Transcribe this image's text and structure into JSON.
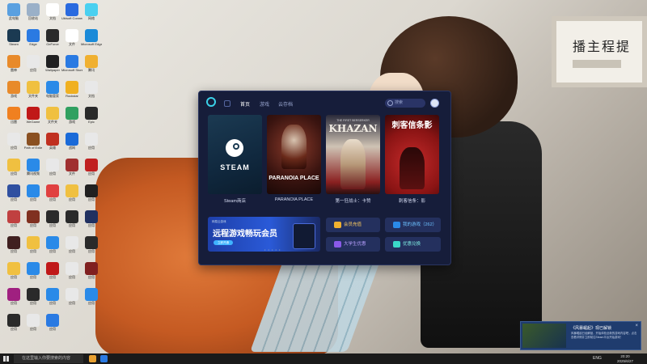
{
  "wallpaper_calligraphy": "播主程提",
  "desktop_icons_left": [
    {
      "label": "此电脑",
      "color": "#5aa0e0"
    },
    {
      "label": "回收站",
      "color": "#9ab0c8"
    },
    {
      "label": "文档",
      "color": "#ffffff"
    },
    {
      "label": "Ubisoft Connect",
      "color": "#2a6adf"
    },
    {
      "label": "网络",
      "color": "#4ad0f0"
    },
    {
      "label": "Steam",
      "color": "#1b3a52"
    },
    {
      "label": "Edge",
      "color": "#2a7ae2"
    },
    {
      "label": "GeForce",
      "color": "#2a2a2a"
    },
    {
      "label": "文件",
      "color": "#ffffff"
    },
    {
      "label": "Microsoft Edge",
      "color": "#1a8ad8"
    },
    {
      "label": "雷神",
      "color": "#e88a2a"
    },
    {
      "label": "应用",
      "color": "#e8e8e8"
    },
    {
      "label": "Wallpaper",
      "color": "#202020"
    },
    {
      "label": "Microsoft Store",
      "color": "#2a7ae2"
    },
    {
      "label": "腾讯",
      "color": "#f0b030"
    },
    {
      "label": "游戏",
      "color": "#e88a2a"
    },
    {
      "label": "文件夹",
      "color": "#f0c040"
    },
    {
      "label": "电脑管家",
      "color": "#2a8ae8"
    },
    {
      "label": "Rockstar",
      "color": "#f0b020"
    },
    {
      "label": "文档",
      "color": "#e8e8e8"
    },
    {
      "label": "迅雷",
      "color": "#f08020"
    },
    {
      "label": "WeGame",
      "color": "#c01818"
    },
    {
      "label": "文件夹",
      "color": "#f0c040"
    },
    {
      "label": "游戏",
      "color": "#30a060"
    },
    {
      "label": "Epic",
      "color": "#2a2a2a"
    },
    {
      "label": "应用",
      "color": "#e8e8e8"
    },
    {
      "label": "Path of Exile",
      "color": "#8a5020"
    },
    {
      "label": "英雄",
      "color": "#c03020"
    },
    {
      "label": "战网",
      "color": "#1a6ad8"
    },
    {
      "label": "应用",
      "color": "#e8e8e8"
    },
    {
      "label": "应用",
      "color": "#f0c040"
    },
    {
      "label": "腾讯视频",
      "color": "#2a8ae8"
    },
    {
      "label": "应用",
      "color": "#e8e8e8"
    },
    {
      "label": "文件",
      "color": "#a03030"
    },
    {
      "label": "应用",
      "color": "#c02020"
    },
    {
      "label": "应用",
      "color": "#3050a0"
    },
    {
      "label": "应用",
      "color": "#2a8ae8"
    },
    {
      "label": "应用",
      "color": "#e04040"
    },
    {
      "label": "应用",
      "color": "#f0c040"
    },
    {
      "label": "应用",
      "color": "#202020"
    },
    {
      "label": "应用",
      "color": "#c04040"
    },
    {
      "label": "应用",
      "color": "#803020"
    },
    {
      "label": "应用",
      "color": "#2a2a2a"
    },
    {
      "label": "应用",
      "color": "#2a2a2a"
    },
    {
      "label": "应用",
      "color": "#203060"
    },
    {
      "label": "应用",
      "color": "#402020"
    },
    {
      "label": "应用",
      "color": "#f0c040"
    },
    {
      "label": "应用",
      "color": "#2a8ae8"
    },
    {
      "label": "应用",
      "color": "#e8e8e8"
    },
    {
      "label": "应用",
      "color": "#2a2a2a"
    },
    {
      "label": "应用",
      "color": "#f0c040"
    },
    {
      "label": "应用",
      "color": "#2a8ae8"
    },
    {
      "label": "应用",
      "color": "#c01818"
    },
    {
      "label": "应用",
      "color": "#e8e8e8"
    },
    {
      "label": "应用",
      "color": "#802020"
    },
    {
      "label": "应用",
      "color": "#a02080"
    },
    {
      "label": "应用",
      "color": "#2a2a2a"
    },
    {
      "label": "应用",
      "color": "#2a8ae8"
    },
    {
      "label": "应用",
      "color": "#e8e8e8"
    },
    {
      "label": "应用",
      "color": "#2a8ae8"
    },
    {
      "label": "应用",
      "color": "#2a2a2a"
    },
    {
      "label": "应用",
      "color": "#e8e8e8"
    },
    {
      "label": "应用",
      "color": "#2a7ae2"
    }
  ],
  "launcher": {
    "nav": [
      "首页",
      "游戏",
      "云存档"
    ],
    "search_placeholder": "搜索",
    "cards": [
      {
        "label": "Steam商店",
        "title": "STEAM"
      },
      {
        "label": "PARANOIA PLACE",
        "title": "PARANOIA PLACE"
      },
      {
        "label": "第一狂战士：卡赞",
        "title": "KHAZAN",
        "subtitle": "THE FIRST BERSERKER"
      },
      {
        "label": "刺客信条：影",
        "title": "刺客信条影"
      }
    ],
    "banner": {
      "tag": "网易云游戏",
      "title": "远程游戏畅玩会员",
      "button": "立即开通",
      "dots": "• • • • •"
    },
    "quick_buttons": [
      {
        "label": "会员充值",
        "color": "#f0b030",
        "text_color": "#f5c660"
      },
      {
        "label": "我的游戏（262）",
        "color": "#2a8ae8",
        "text_color": "#6cc0ff"
      },
      {
        "label": "大学生优惠",
        "color": "#8a5ae8",
        "text_color": "#b8a0ff"
      },
      {
        "label": "优惠兑换",
        "color": "#3ad8c8",
        "text_color": "#7ee8e0"
      }
    ]
  },
  "popup": {
    "title": "《风暴崛起》现已解锁",
    "text": "风暴崛起已经解锁，开始体验全新的游戏内容吧，点击查看详情并立即前往Steam平台开始游戏！",
    "close": "×"
  },
  "taskbar": {
    "search_placeholder": "在这里输入你要搜索的内容",
    "tray": "ENG",
    "time": "20:20",
    "date": "2025/6/27"
  }
}
